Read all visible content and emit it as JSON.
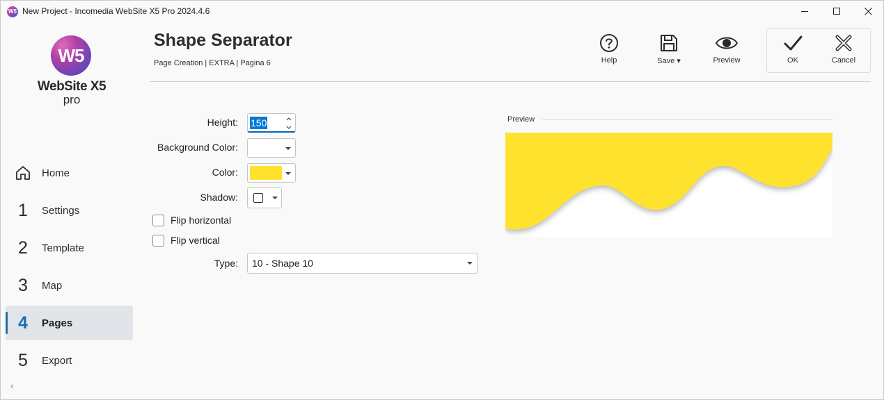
{
  "window": {
    "title": "New Project - Incomedia WebSite X5 Pro 2024.4.6",
    "app_icon_text": "W5"
  },
  "logo": {
    "mark": "W5",
    "name": "WebSite X5",
    "edition": "pro"
  },
  "sidebar": {
    "items": [
      {
        "num": "",
        "label": "Home",
        "icon": "home-icon"
      },
      {
        "num": "1",
        "label": "Settings"
      },
      {
        "num": "2",
        "label": "Template"
      },
      {
        "num": "3",
        "label": "Map"
      },
      {
        "num": "4",
        "label": "Pages",
        "active": true
      },
      {
        "num": "5",
        "label": "Export"
      }
    ],
    "collapse_glyph": "‹"
  },
  "header": {
    "title": "Shape Separator",
    "breadcrumb": "Page Creation | EXTRA | Pagina 6"
  },
  "toolbar": {
    "help_label": "Help",
    "save_label": "Save ▾",
    "preview_label": "Preview",
    "ok_label": "OK",
    "cancel_label": "Cancel"
  },
  "form": {
    "height_label": "Height:",
    "height_value": "150",
    "bg_color_label": "Background Color:",
    "bg_color_value": "#ffffff",
    "color_label": "Color:",
    "color_value": "#ffe22e",
    "shadow_label": "Shadow:",
    "shadow_checked": false,
    "flip_horizontal_label": "Flip horizontal",
    "flip_horizontal_checked": false,
    "flip_vertical_label": "Flip vertical",
    "flip_vertical_checked": false,
    "type_label": "Type:",
    "type_value": "10 - Shape 10"
  },
  "preview": {
    "label": "Preview",
    "fill_color": "#ffe22e",
    "background": "#ffffff"
  },
  "colors": {
    "accent": "#0078d4",
    "active_nav_bg": "#e1e4e8",
    "active_nav_text": "#1a6fb0"
  }
}
